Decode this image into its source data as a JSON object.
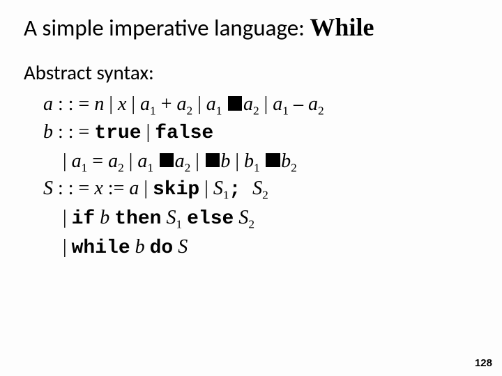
{
  "title_prefix": "A simple imperative language: ",
  "title_lang": "While",
  "subhead": "Abstract syntax:",
  "grammar": {
    "a_lhs": "a",
    "def": " : : = ",
    "a_n": "n",
    "bar": " | ",
    "a_x": "x",
    "a_plus": " + ",
    "a_minus": " – ",
    "a1": "a",
    "a2": "a",
    "sub1": "1",
    "sub2": "2",
    "b_lhs": "b",
    "true": "true",
    "false": "false",
    "eq": " = ",
    "b_sym": "b",
    "b1": "b",
    "b2": "b",
    "S_lhs": "S",
    "assign": " := ",
    "skip": "skip",
    "semi": "; ",
    "S1": "S",
    "S2": "S",
    "S_sym": "S",
    "if": "if",
    "then": "then",
    "else": "else",
    "while": "while",
    "do": "do"
  },
  "page_number": "128"
}
